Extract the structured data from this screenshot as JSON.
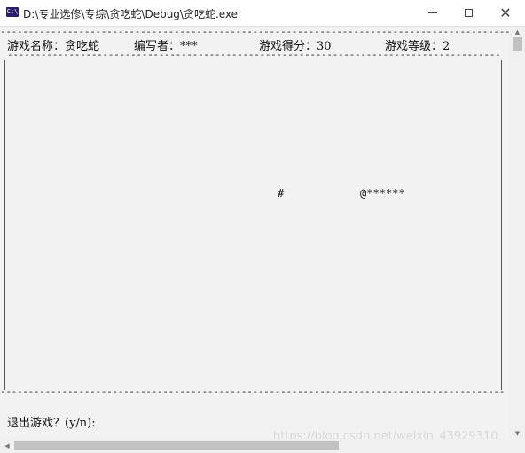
{
  "window": {
    "title": "D:\\专业选修\\专综\\贪吃蛇\\Debug\\贪吃蛇.exe",
    "icon_label": "C:\\"
  },
  "hud": {
    "game_name": "游戏名称：贪吃蛇",
    "author": "编写者：***",
    "score": "游戏得分：30",
    "level": "游戏等级：2"
  },
  "board": {
    "border_line": "------------------------------------------------------------------------------------------------------",
    "food": "#",
    "snake": "@******"
  },
  "prompt": "退出游戏？(y/n):",
  "watermark": "https://blog.csdn.net/weixin_43929310",
  "colors": {
    "titlebar": "#ffffff",
    "console_bg": "#f2f2f2",
    "icon_bg": "#2b1d6a"
  }
}
